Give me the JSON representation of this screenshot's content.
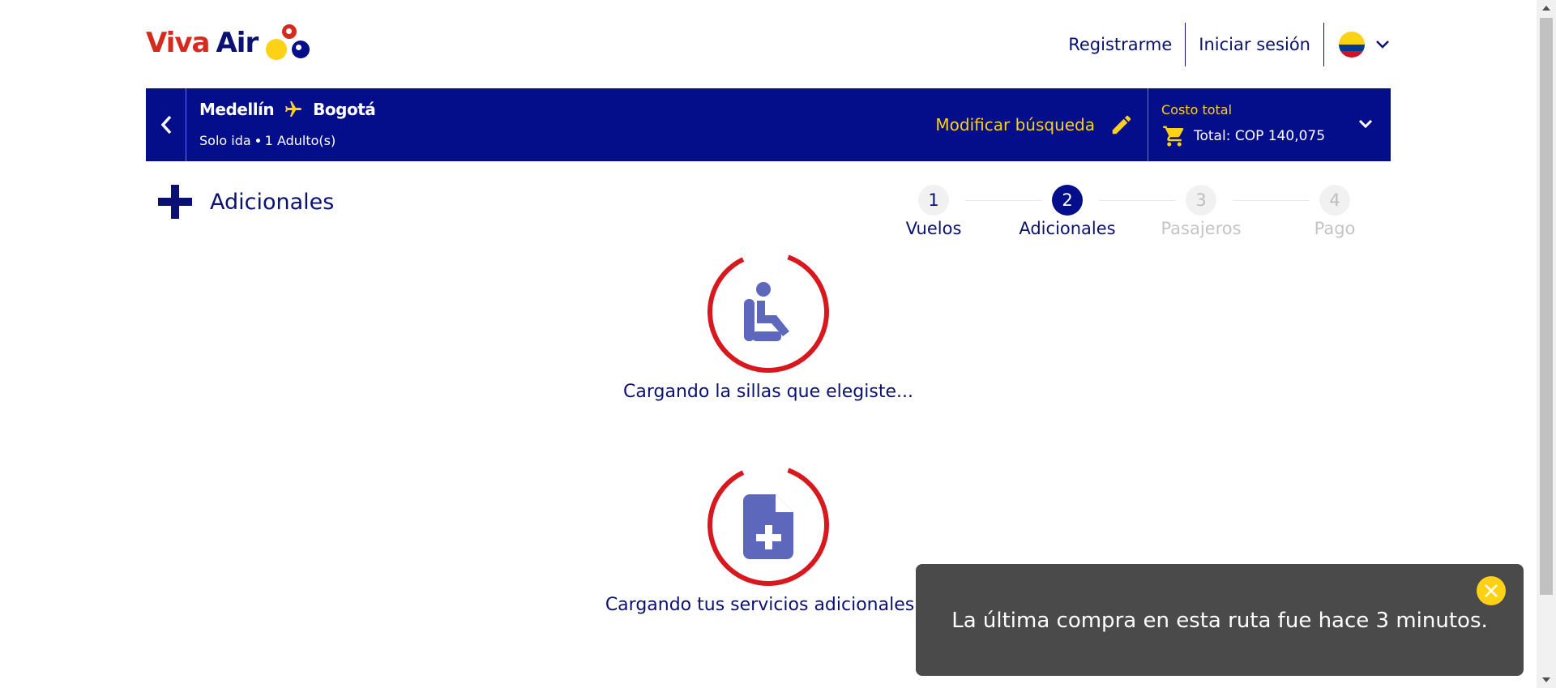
{
  "header": {
    "logo": {
      "word1": "Viva",
      "word2": "Air"
    },
    "nav": {
      "register": "Registrarme",
      "login": "Iniciar sesión"
    },
    "country_flag": "colombia-flag",
    "colors": {
      "brand_blue": "#040e8b",
      "brand_red": "#d52b1e",
      "brand_yellow": "#fcd116"
    }
  },
  "booking_bar": {
    "origin": "Medellín",
    "destination": "Bogotá",
    "trip_type": "Solo ida",
    "passengers": "1 Adulto(s)",
    "modify_label": "Modificar búsqueda",
    "cost_label": "Costo total",
    "total": "Total: COP 140,075"
  },
  "page": {
    "section_title": "Adicionales"
  },
  "stepper": {
    "steps": [
      {
        "number": "1",
        "label": "Vuelos",
        "state": "done"
      },
      {
        "number": "2",
        "label": "Adicionales",
        "state": "active"
      },
      {
        "number": "3",
        "label": "Pasajeros",
        "state": "todo"
      },
      {
        "number": "4",
        "label": "Pago",
        "state": "todo"
      }
    ]
  },
  "loaders": {
    "seats": {
      "text": "Cargando la sillas que elegiste...",
      "icon": "seat-icon"
    },
    "services": {
      "text": "Cargando tus servicios adicionales...",
      "icon": "document-add-icon"
    }
  },
  "toast": {
    "message": "La última compra en esta ruta fue hace 3 minutos."
  }
}
